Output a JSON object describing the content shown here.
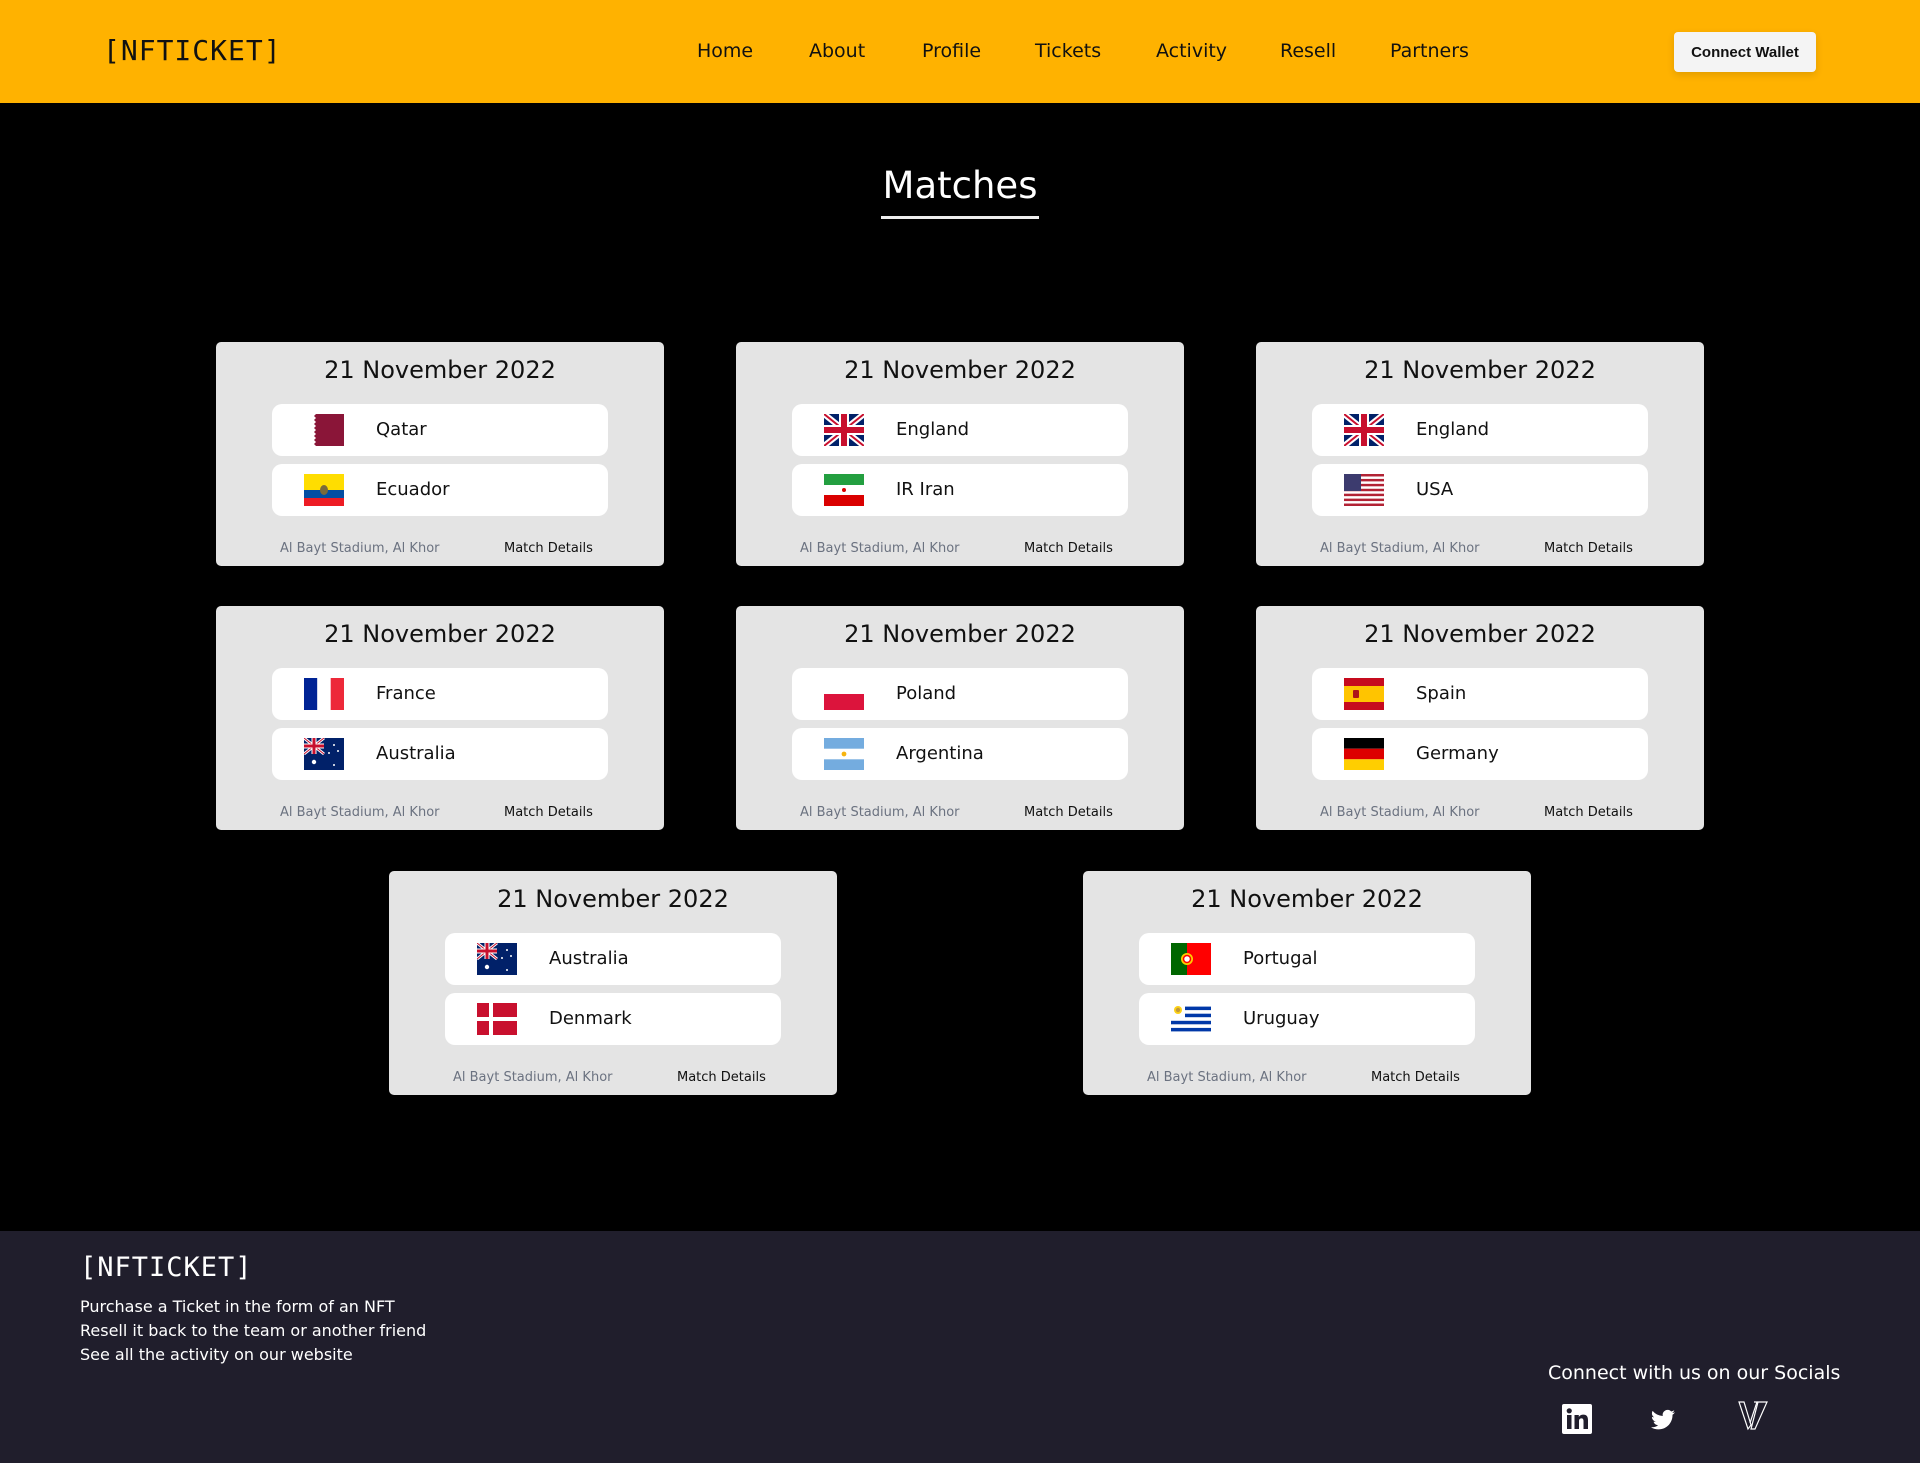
{
  "header": {
    "logo": "[NFTICKET]",
    "nav": [
      "Home",
      "About",
      "Profile",
      "Tickets",
      "Activity",
      "Resell",
      "Partners"
    ],
    "connect_wallet_label": "Connect Wallet"
  },
  "main": {
    "title": "Matches",
    "matches": [
      {
        "date": "21 November 2022",
        "team1": "Qatar",
        "flag1": "qatar-flag",
        "team2": "Ecuador",
        "flag2": "ecuador-flag",
        "venue": "Al Bayt Stadium, Al Khor",
        "details_label": "Match Details"
      },
      {
        "date": "21 November 2022",
        "team1": "England",
        "flag1": "uk-flag",
        "team2": "IR Iran",
        "flag2": "iran-flag",
        "venue": "Al Bayt Stadium, Al Khor",
        "details_label": "Match Details"
      },
      {
        "date": "21 November 2022",
        "team1": "England",
        "flag1": "uk-flag",
        "team2": "USA",
        "flag2": "usa-flag",
        "venue": "Al Bayt Stadium, Al Khor",
        "details_label": "Match Details"
      },
      {
        "date": "21 November 2022",
        "team1": "France",
        "flag1": "france-flag",
        "team2": "Australia",
        "flag2": "australia-flag",
        "venue": "Al Bayt Stadium, Al Khor",
        "details_label": "Match Details"
      },
      {
        "date": "21 November 2022",
        "team1": "Poland",
        "flag1": "poland-flag",
        "team2": "Argentina",
        "flag2": "argentina-flag",
        "venue": "Al Bayt Stadium, Al Khor",
        "details_label": "Match Details"
      },
      {
        "date": "21 November 2022",
        "team1": "Spain",
        "flag1": "spain-flag",
        "team2": "Germany",
        "flag2": "germany-flag",
        "venue": "Al Bayt Stadium, Al Khor",
        "details_label": "Match Details"
      },
      {
        "date": "21 November 2022",
        "team1": "Australia",
        "flag1": "australia-flag",
        "team2": "Denmark",
        "flag2": "denmark-flag",
        "venue": "Al Bayt Stadium, Al Khor",
        "details_label": "Match Details"
      },
      {
        "date": "21 November 2022",
        "team1": "Portugal",
        "flag1": "portugal-flag",
        "team2": "Uruguay",
        "flag2": "uruguay-flag",
        "venue": "Al Bayt Stadium, Al Khor",
        "details_label": "Match Details"
      }
    ]
  },
  "footer": {
    "logo": "[NFTICKET]",
    "lines": [
      "Purchase a Ticket in the form of an NFT",
      "Resell it back to the team or another friend",
      "See all the activity on our website"
    ],
    "socials_title": "Connect with us on our Socials",
    "socials": [
      "linkedin-icon",
      "twitter-icon",
      "v-brand-icon"
    ]
  },
  "colors": {
    "header_bg": "#FFB200",
    "page_bg": "#000000",
    "card_bg": "#E4E4E4",
    "footer_bg": "#201E2C"
  }
}
